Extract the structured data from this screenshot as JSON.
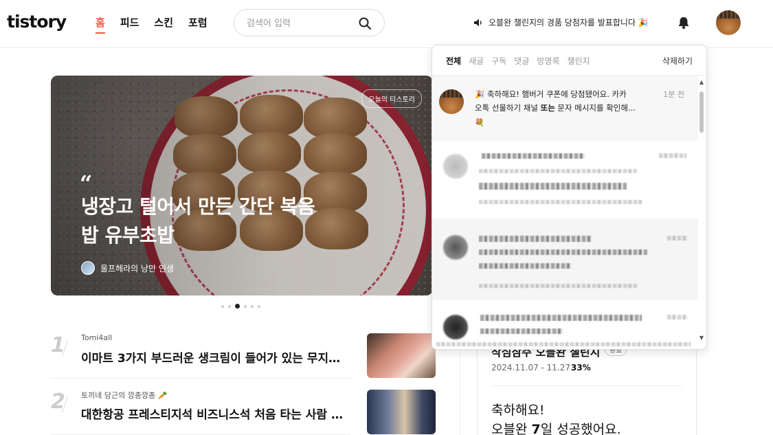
{
  "header": {
    "logo": "tistory",
    "nav": [
      "홈",
      "피드",
      "스킨",
      "포럼"
    ],
    "search_placeholder": "검색어 입력",
    "announcement": "오블완 챌린지의 경품 당첨자를 발표합니다 🎉"
  },
  "hero": {
    "badge": "오늘의 티스토리",
    "quote_mark": "“",
    "title": "냉장고 털어서 만든 간단 복음밥 유부초밥",
    "author": "울프헤라의 낭만 인생",
    "slide_count": 6,
    "active_slide": 3
  },
  "list": [
    {
      "rank": "1",
      "blog": "Tomi4all",
      "title": "이마트 3가지 부드러운 생크림이 들어가 있는 무지개 ..."
    },
    {
      "rank": "2",
      "blog": "토끼네 당근의 깡총깡총 🥕",
      "title": "대한항공 프레스티지석 비즈니스석 처음 타는 사람 후기"
    }
  ],
  "challenge": {
    "title": "작심삼주 오블완 챌린지",
    "tag": "종료",
    "date": "2024.11.07 - 11.27",
    "separator": "·",
    "percent": "33%",
    "congrats_line1": "축하해요!",
    "congrats_line2_pre": "오블완 ",
    "congrats_line2_num": "7",
    "congrats_line2_post": "일 성공했어요."
  },
  "notifications": {
    "tabs": [
      "전체",
      "새글",
      "구독",
      "댓글",
      "방명록",
      "챌린지"
    ],
    "active_tab": "전체",
    "clear_label": "삭제하기",
    "first": {
      "line1": "🎉 축하해요! 햄버거 쿠폰에 당첨됐어요. 카카",
      "line2_pre": "오톡 선물하기 채널 ",
      "line2_bold": "또는",
      "line2_post": " 문자 메시지를 확인해...",
      "time": "1분 전",
      "emoji": "💐"
    }
  },
  "colors": {
    "accent": "#ff5544",
    "hero_plate_rim": "#9c2233"
  }
}
